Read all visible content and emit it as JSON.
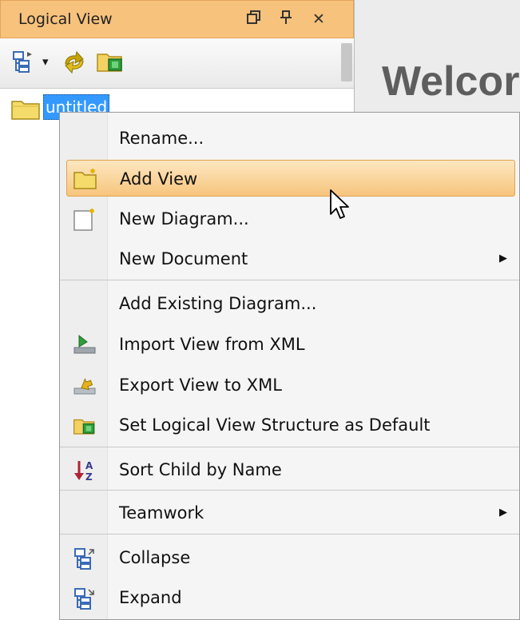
{
  "panel": {
    "title": "Logical View",
    "restore_icon": "restore-window-icon",
    "pin_icon": "pin-icon",
    "close_icon": "close-icon",
    "close_glyph": "✕",
    "toolbar": [
      "structure-tree-icon",
      "dropdown-arrow-icon",
      "refresh-icon",
      "logical-view-default-icon"
    ]
  },
  "tree": {
    "root_label": "untitled"
  },
  "main": {
    "welcome": "Welcor"
  },
  "menu": {
    "items": [
      {
        "label": "Rename...",
        "icon": ""
      },
      {
        "label": "Add View",
        "icon": "folder-new-icon",
        "highlighted": true
      },
      {
        "label": "New Diagram...",
        "icon": "new-diagram-icon"
      },
      {
        "label": "New Document",
        "icon": "",
        "submenu": true
      },
      {
        "label": "Add Existing Diagram...",
        "icon": ""
      },
      {
        "label": "Import View from XML",
        "icon": "import-xml-icon"
      },
      {
        "label": "Export View to XML",
        "icon": "export-xml-icon"
      },
      {
        "label": "Set Logical View Structure as Default",
        "icon": "logical-view-default-icon"
      },
      {
        "label": "Sort Child by Name",
        "icon": "sort-az-icon"
      },
      {
        "label": "Teamwork",
        "icon": "",
        "submenu": true
      },
      {
        "label": "Collapse",
        "icon": "collapse-icon"
      },
      {
        "label": "Expand",
        "icon": "expand-icon"
      }
    ],
    "submenu_glyph": "▶"
  },
  "colors": {
    "titlebar": "#f6c27c",
    "highlight": "#f7c57d",
    "selection": "#3399ff"
  }
}
